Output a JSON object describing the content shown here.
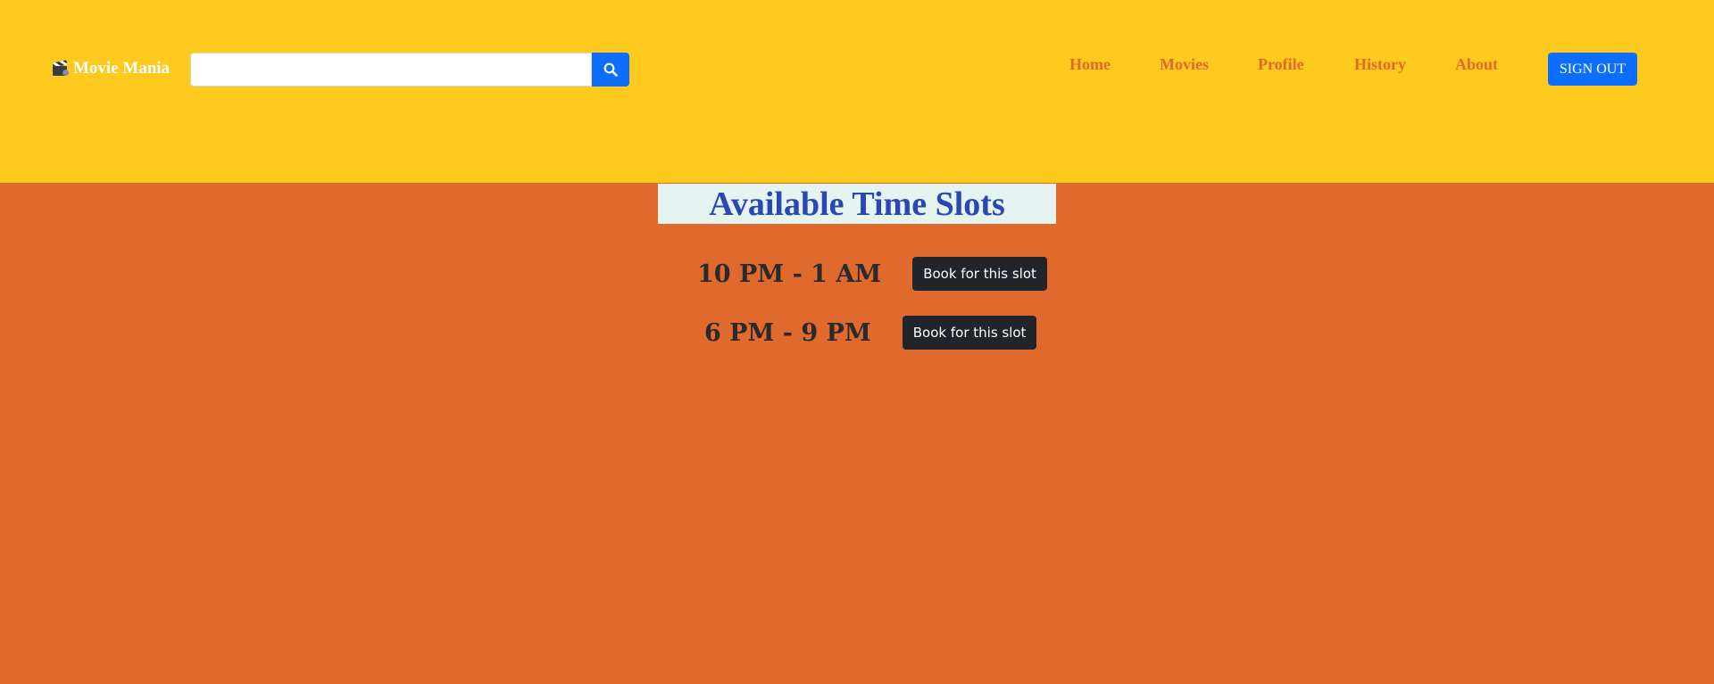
{
  "brand": {
    "name": "Movie Mania",
    "icon": "clapperboard-icon"
  },
  "search": {
    "value": "",
    "placeholder": "",
    "button_icon": "search-icon"
  },
  "nav": {
    "items": [
      {
        "label": "Home"
      },
      {
        "label": "Movies"
      },
      {
        "label": "Profile"
      },
      {
        "label": "History"
      },
      {
        "label": "About"
      }
    ],
    "signout_label": "SIGN OUT"
  },
  "main": {
    "title": "Available Time Slots",
    "slots": [
      {
        "time": "10 PM - 1 AM",
        "button_label": "Book for this slot"
      },
      {
        "time": "6 PM - 9 PM",
        "button_label": "Book for this slot"
      }
    ]
  },
  "colors": {
    "header_bg": "#ffca1e",
    "page_bg": "#e0692d",
    "primary_button": "#0d6efd",
    "nav_link": "#e0692d",
    "title_text": "#2a47b3",
    "title_bg": "#e6f4f1",
    "book_button": "#212529"
  }
}
